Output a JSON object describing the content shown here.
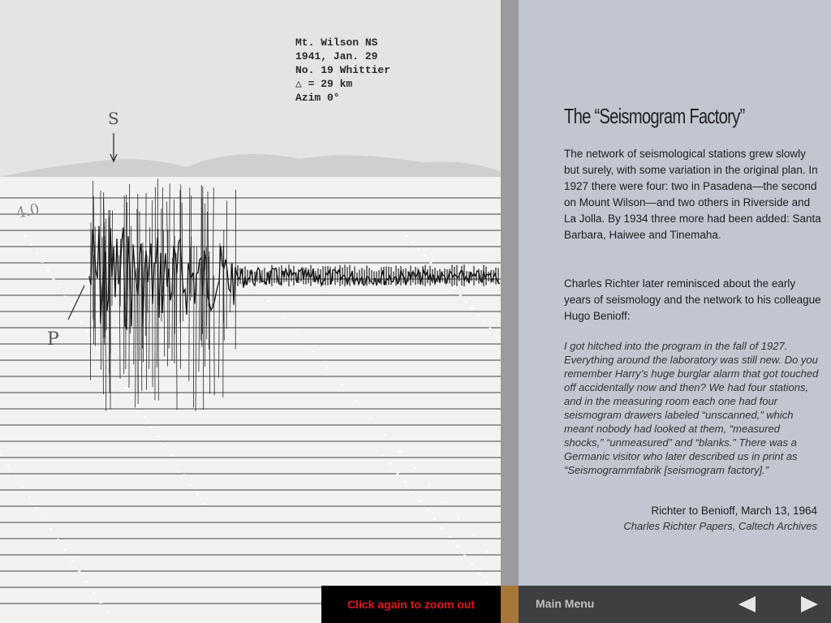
{
  "seismogram": {
    "stamp_lines": [
      "Mt. Wilson NS",
      "1941, Jan. 29",
      "No. 19 Whittier",
      "△ = 29 km",
      "Azim 0°"
    ],
    "hand_s": "S",
    "hand_p": "P",
    "hand_magnitude": "4.0"
  },
  "article": {
    "title": "The “Seismogram Factory”",
    "paragraph1": "The network of seismological stations grew slowly but surely, with some variation in the original plan. In 1927 there were four: two in Pasadena—the second on Mount Wilson—and two others in Riverside and La Jolla. By 1934 three more had been added: Santa Barbara, Haiwee and Tinemaha.",
    "paragraph2": "Charles Richter later reminisced about the early years of seismology and the network to his colleague Hugo Benioff:",
    "quote": "I got hitched into the program in the fall of 1927. Everything around the laboratory was still new. Do you remember Harry’s huge burglar alarm that got touched off accidentally now and then? We had four stations, and in the measuring room each one had four seismogram drawers labeled “unscanned,” which meant nobody had looked at them, “measured shocks,” “unmeasured” and “blanks.” There was a Germanic visitor who later described us in print as “Seismogrammfabrik [seismogram factory].”",
    "citation": "Richter to Benioff, March 13, 1964",
    "source": "Charles Richter Papers, Caltech Archives"
  },
  "bottom_bar": {
    "zoom_out_label": "Click again to zoom out",
    "main_menu_label": "Main Menu",
    "prev_icon": "left-arrow",
    "next_icon": "right-arrow",
    "zoom_text_color": "#e8141b"
  }
}
